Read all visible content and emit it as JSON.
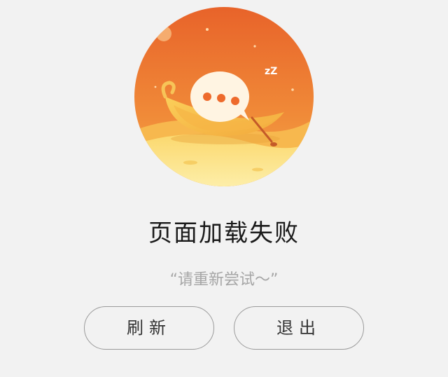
{
  "status": {
    "title": "页面加载失败",
    "subtitle": "“请重新尝试～”"
  },
  "actions": {
    "refresh_label": "刷新",
    "exit_label": "退出"
  },
  "illustration": {
    "icon": "sleeping-chat-bubble-boat-icon",
    "zzz_text": "zZ",
    "colors": {
      "sky_top": "#ea6a2c",
      "sky_bottom": "#f6a243",
      "sand": "#fbe488",
      "boat": "#f8c24f",
      "bubble": "#fff6e8"
    }
  }
}
